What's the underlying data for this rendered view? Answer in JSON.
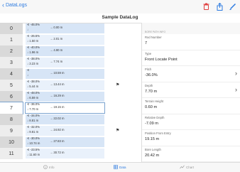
{
  "nav": {
    "back_label": "DataLogs"
  },
  "title": "Sample DataLog",
  "rows": [
    {
      "idx": "0",
      "pitch": "-46.0%",
      "depth": "",
      "pos": "0.00 m",
      "style": "a",
      "flag": false
    },
    {
      "idx": "1",
      "pitch": "-26.5%",
      "depth": "1.50 m",
      "pos": "2.01 m",
      "style": "b",
      "flag": false
    },
    {
      "idx": "2",
      "pitch": "-40.0%",
      "depth": "1.96 m",
      "pos": "4.90 m",
      "style": "a",
      "flag": false
    },
    {
      "idx": "3",
      "pitch": "-38.0%",
      "depth": "3.23 m",
      "pos": "7.74 m",
      "style": "b",
      "flag": false
    },
    {
      "idx": "4",
      "pitch": "",
      "depth": "",
      "pos": "10.59 m",
      "style": "a",
      "flag": false
    },
    {
      "idx": "5",
      "pitch": "-38.0%",
      "depth": "5.44 m",
      "pos": "13.44 m",
      "style": "b",
      "flag": true
    },
    {
      "idx": "6",
      "pitch": "-48.0%",
      "depth": "6.59 m",
      "pos": "16.29 m",
      "style": "a",
      "flag": false
    },
    {
      "idx": "7",
      "pitch": "-36.0%",
      "depth": "7.70 m",
      "pos": "19.15 m",
      "style": "sel",
      "flag": false
    },
    {
      "idx": "8",
      "pitch": "-34.0%",
      "depth": "8.81 m",
      "pos": "22.02 m",
      "style": "a",
      "flag": false
    },
    {
      "idx": "9",
      "pitch": "-32.0%",
      "depth": "9.81 m",
      "pos": "24.92 m",
      "style": "b",
      "flag": true
    },
    {
      "idx": "10",
      "pitch": "-30.0%",
      "depth": "10.74 m",
      "pos": "27.83 m",
      "style": "a",
      "flag": false
    },
    {
      "idx": "11",
      "pitch": "-23.5%",
      "depth": "11.60 m",
      "pos": "30.72 m",
      "style": "b",
      "flag": false
    }
  ],
  "detail": {
    "section": "BORE PATH INFO",
    "fields": [
      {
        "label": "Rod Number",
        "value": "7",
        "arrow": false
      },
      {
        "label": "Type",
        "value": "Front Locate Point",
        "arrow": false
      },
      {
        "label": "Pitch",
        "value": "-36.0%",
        "arrow": true
      },
      {
        "label": "Depth",
        "value": "7.70 m",
        "arrow": true
      },
      {
        "label": "Terrain Height",
        "value": "0.60 m",
        "arrow": false
      },
      {
        "label": "Relative Depth",
        "value": "-7.09 m",
        "arrow": false
      },
      {
        "label": "Position From Entry",
        "value": "19.15 m",
        "arrow": false
      },
      {
        "label": "Bore Length",
        "value": "20.42 m",
        "arrow": false
      }
    ]
  },
  "tabs": [
    {
      "label": "Info",
      "icon": "info-icon"
    },
    {
      "label": "Data",
      "icon": "grid-icon"
    },
    {
      "label": "Chart",
      "icon": "chart-icon"
    }
  ],
  "colors": {
    "accent": "#2d7be0",
    "delete": "#e04040"
  }
}
